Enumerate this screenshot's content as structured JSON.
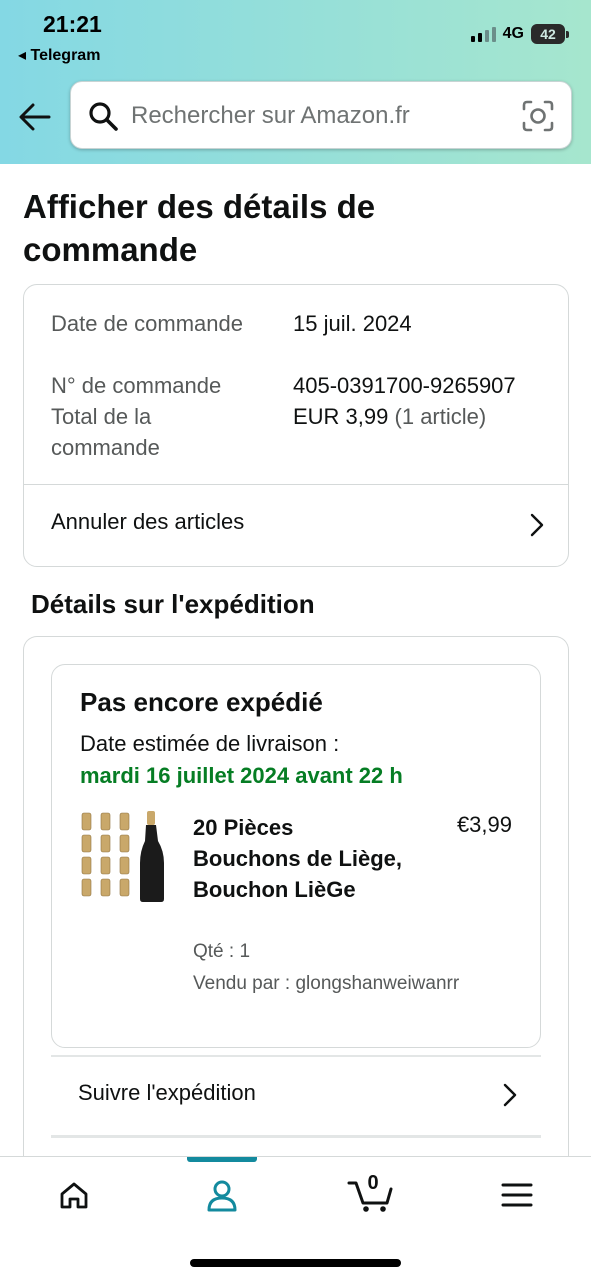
{
  "status_bar": {
    "time": "21:21",
    "back_app": "◂ Telegram",
    "network": "4G",
    "battery": "42"
  },
  "search": {
    "placeholder": "Rechercher sur Amazon.fr"
  },
  "page": {
    "title": "Afficher des détails de commande"
  },
  "order_summary": {
    "date_label": "Date de commande",
    "date_value": "15 juil. 2024",
    "number_label": "N° de commande",
    "number_value": "405-0391700-9265907",
    "total_label": "Total de la commande",
    "total_value": "EUR 3,99",
    "total_count": "(1 article)",
    "cancel_label": "Annuler des articles"
  },
  "shipment": {
    "section_title": "Détails sur l'expédition",
    "status": "Pas encore expédié",
    "estimate_label": "Date estimée de livraison :",
    "estimate_date": "mardi 16 juillet 2024 avant 22 h",
    "item": {
      "title": "20 Pièces Bouchons de Liège, Bouchon LièGe",
      "price": "€3,99",
      "quantity": "Qté : 1",
      "seller": "Vendu par : glongshanweiwanrr"
    },
    "track_label": "Suivre l'expédition"
  },
  "tabbar": {
    "items": [
      {
        "icon": "home-icon"
      },
      {
        "icon": "account-icon",
        "active": true
      },
      {
        "icon": "cart-icon"
      },
      {
        "icon": "menu-icon"
      }
    ],
    "cart_count": "0",
    "accent_color": "#138a9e"
  },
  "colors": {
    "header_gradient_start": "#84d8e4",
    "header_gradient_end": "#a6e6ce",
    "delivery_green": "#067d24",
    "muted_text": "#565959"
  }
}
